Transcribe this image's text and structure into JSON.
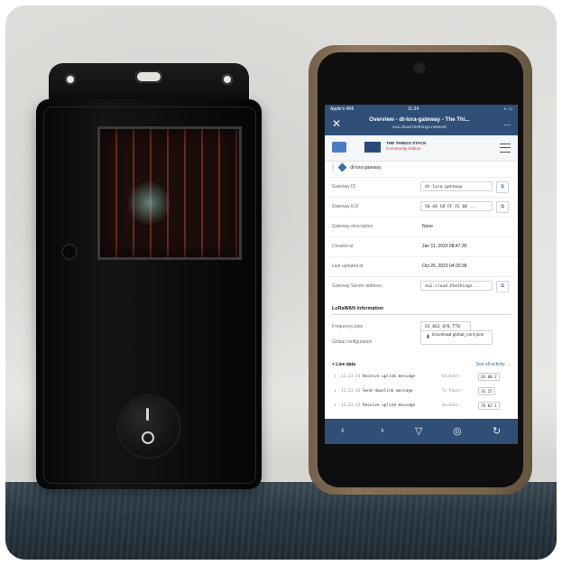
{
  "phone": {
    "status": {
      "carrier": "Apple's Wifi",
      "time": "11:24",
      "battery": "◐ ▭"
    },
    "browser": {
      "title": "Overview - dt-lora-gateway - The Thi...",
      "url": "eu1.cloud.thethings.network",
      "close_icon": "close-icon",
      "more": "..."
    },
    "site": {
      "brand_line1": "THE THINGS STACK",
      "brand_line2": "Community Edition"
    },
    "breadcrumb": "dt-lora-gateway",
    "rows": [
      {
        "label": "Gateway ID",
        "value": "dt-lora-gateway",
        "boxed": true,
        "copy": true
      },
      {
        "label": "Gateway EUI",
        "value": "58 A0 CB FF FE 80 ...",
        "boxed": true,
        "copy": true
      },
      {
        "label": "Gateway description",
        "value": "None",
        "boxed": false,
        "copy": false
      },
      {
        "label": "Created at",
        "value": "Jan 11, 2023 08:47:30",
        "boxed": false,
        "copy": false
      },
      {
        "label": "Last updated at",
        "value": "Oct 26, 2023 04:20:38",
        "boxed": false,
        "copy": false
      },
      {
        "label": "Gateway Server address",
        "value": "eu1.cloud.thethings...",
        "boxed": true,
        "copy": true
      }
    ],
    "lorawan": {
      "section_title": "LoRaWAN information",
      "frequency_label": "Frequency plan",
      "frequency_value": "EU_863_870_TTN",
      "global_label": "Global configuration",
      "download_label": "Download global_conf.json"
    },
    "live": {
      "title": "+ Live data",
      "link": "See all activity →",
      "events": [
        {
          "arrow": "↑",
          "time": "11:23:33",
          "msg": "Receive uplink message",
          "key": "DevAddr:",
          "val": "26 0B 2"
        },
        {
          "arrow": "↓",
          "time": "11:23:33",
          "msg": "Send downlink message",
          "key": "Tx Power:",
          "val": "16.15"
        },
        {
          "arrow": "↑",
          "time": "11:23:33",
          "msg": "Receive uplink message",
          "key": "DevAddr:",
          "val": "78 02 1"
        }
      ]
    },
    "nav": {
      "back": "‹",
      "forward": "›",
      "share": "▽",
      "compass": "◎",
      "reload": "↻"
    }
  },
  "device": {
    "switch_on": "I",
    "switch_off": "O"
  }
}
